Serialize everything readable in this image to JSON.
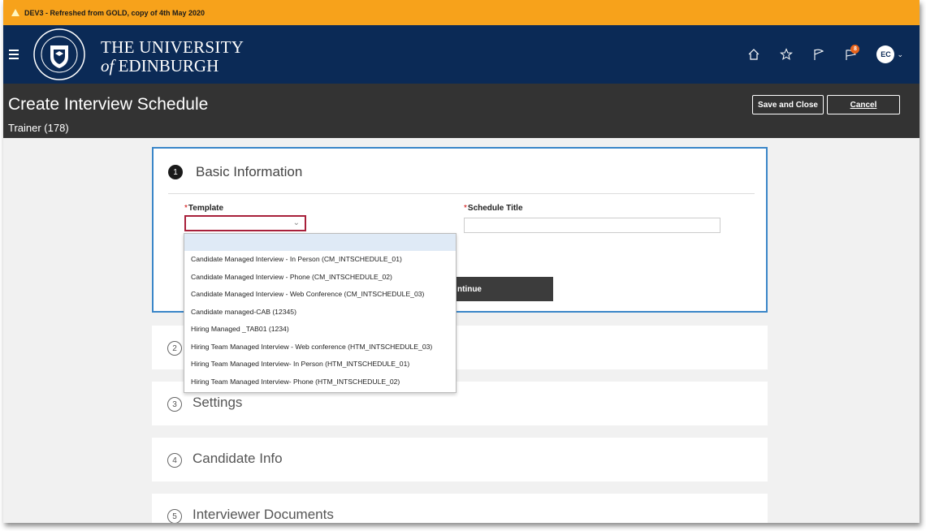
{
  "banner": {
    "text": "DEV3 - Refreshed from GOLD, copy of 4th May 2020"
  },
  "header": {
    "brand_line1": "THE UNIVERSITY",
    "brand_of": "of",
    "brand_line2": "EDINBURGH",
    "notification_count": "8",
    "avatar_initials": "EC",
    "icons": [
      "menu-icon",
      "home-icon",
      "star-icon",
      "flag-icon",
      "notifications-icon",
      "chevron-down-icon"
    ]
  },
  "page": {
    "title": "Create Interview Schedule",
    "subtitle": "Trainer (178)",
    "save_close_label": "Save and Close",
    "cancel_label": "Cancel"
  },
  "step1": {
    "number": "1",
    "title": "Basic Information",
    "template_label": "Template",
    "schedule_title_label": "Schedule Title",
    "continue_label": "ntinue",
    "required_mark": "*"
  },
  "template_options": [
    "Candidate Managed Interview - In Person (CM_INTSCHEDULE_01)",
    "Candidate Managed Interview - Phone (CM_INTSCHEDULE_02)",
    "Candidate Managed Interview - Web Conference (CM_INTSCHEDULE_03)",
    "Candidate managed-CAB (12345)",
    "Hiring Managed _TAB01 (1234)",
    "Hiring Team Managed Interview - Web conference (HTM_INTSCHEDULE_03)",
    "Hiring Team Managed Interview- In Person (HTM_INTSCHEDULE_01)",
    "Hiring Team Managed Interview- Phone (HTM_INTSCHEDULE_02)"
  ],
  "steps": [
    {
      "number": "2",
      "title": ""
    },
    {
      "number": "3",
      "title": "Settings"
    },
    {
      "number": "4",
      "title": "Candidate Info"
    },
    {
      "number": "5",
      "title": "Interviewer Documents"
    }
  ],
  "colors": {
    "banner": "#f7a21b",
    "header": "#0b2a56",
    "titlebar": "#333333",
    "focus": "#a8203a",
    "active_step": "#3a86c8"
  }
}
